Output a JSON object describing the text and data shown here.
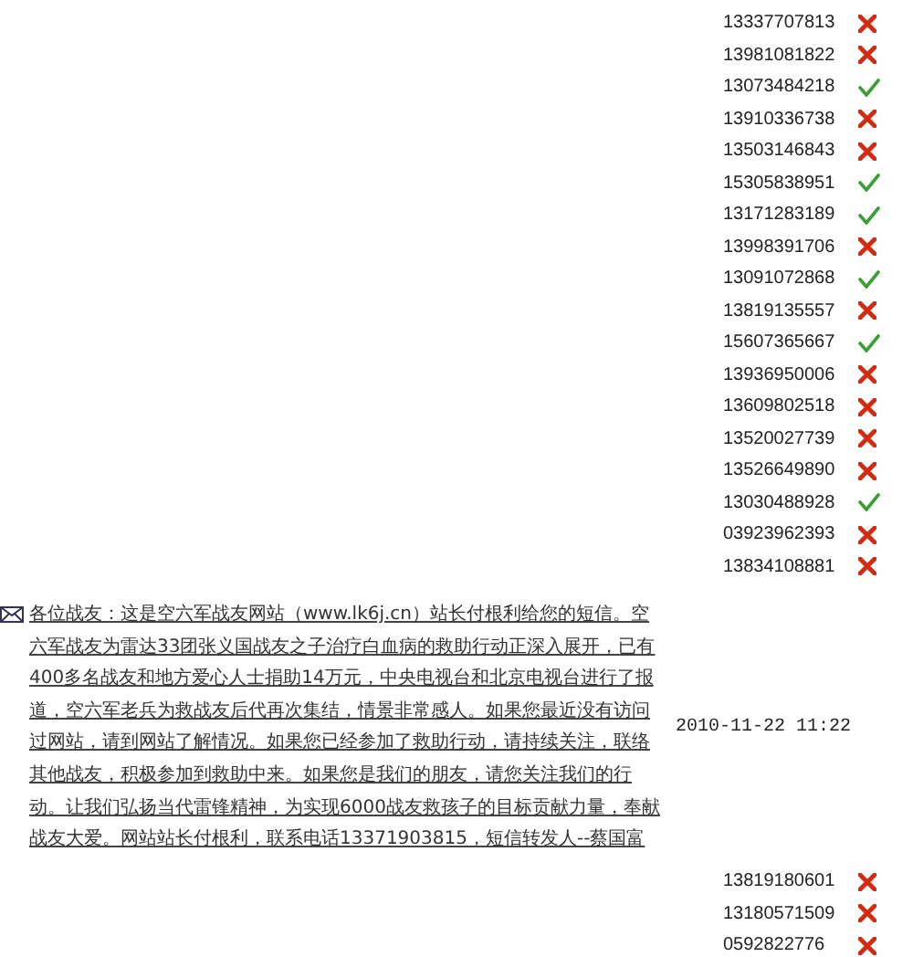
{
  "recipients": [
    {
      "phone": "13337707813",
      "sent": false
    },
    {
      "phone": "13981081822",
      "sent": false
    },
    {
      "phone": "13073484218",
      "sent": true
    },
    {
      "phone": "13910336738",
      "sent": false
    },
    {
      "phone": "13503146843",
      "sent": false
    },
    {
      "phone": "15305838951",
      "sent": true
    },
    {
      "phone": "13171283189",
      "sent": true
    },
    {
      "phone": "13998391706",
      "sent": false
    },
    {
      "phone": "13091072868",
      "sent": true
    },
    {
      "phone": "13819135557",
      "sent": false
    },
    {
      "phone": "15607365667",
      "sent": true
    },
    {
      "phone": "13936950006",
      "sent": false
    },
    {
      "phone": "13609802518",
      "sent": false
    },
    {
      "phone": "13520027739",
      "sent": false
    },
    {
      "phone": "13526649890",
      "sent": false
    },
    {
      "phone": "13030488928",
      "sent": true
    },
    {
      "phone": "03923962393",
      "sent": false
    },
    {
      "phone": "13834108881",
      "sent": false
    }
  ],
  "message": {
    "text": "各位战友：这是空六军战友网站（www.lk6j.cn）站长付根利给您的短信。空六军战友为雷达33团张义国战友之子治疗白血病的救助行动正深入展开，已有400多名战友和地方爱心人士捐助14万元，中央电视台和北京电视台进行了报道，空六军老兵为救战友后代再次集结，情景非常感人。如果您最近没有访问过网站，请到网站了解情况。如果您已经参加了救助行动，请持续关注，联络其他战友，积极参加到救助中来。如果您是我们的朋友，请您关注我们的行动。让我们弘扬当代雷锋精神，为实现6000战友救孩子的目标贡献力量，奉献战友大爱。网站站长付根利，联系电话13371903815，短信转发人--蔡国富",
    "time": "2010-11-22 11:22"
  },
  "recipients_2": [
    {
      "phone": "13819180601",
      "sent": false
    },
    {
      "phone": "13180571509",
      "sent": false
    },
    {
      "phone": "0592822776",
      "sent": false
    }
  ]
}
